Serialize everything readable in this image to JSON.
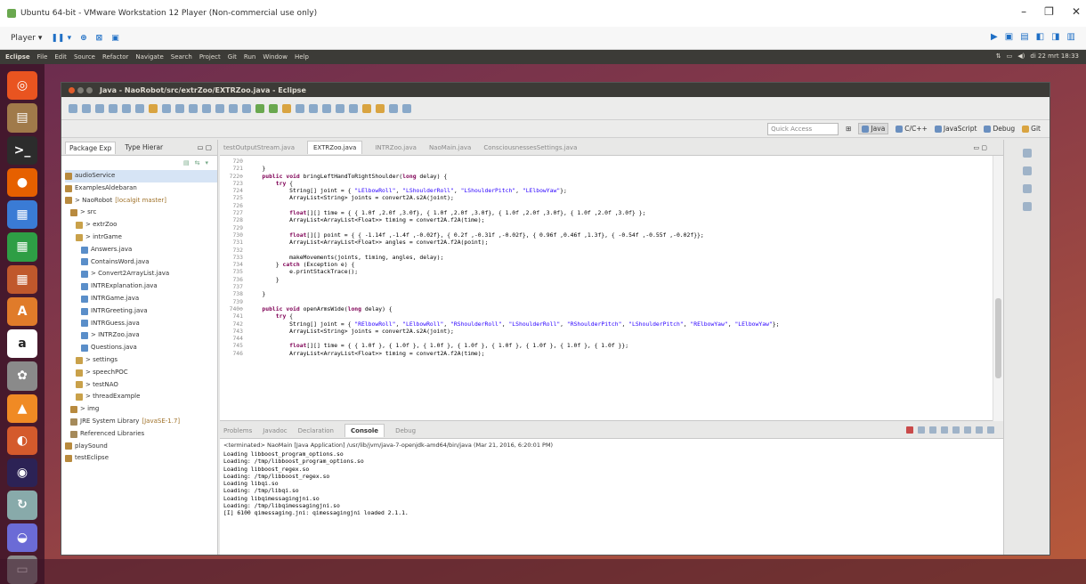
{
  "vmware": {
    "title": "Ubuntu 64-bit - VMware Workstation 12 Player (Non-commercial use only)",
    "player_menu": "Player ▾",
    "window_controls": [
      "–",
      "❐",
      "✕"
    ]
  },
  "ubuntu_panel": {
    "app_name": "Eclipse",
    "menus": [
      "File",
      "Edit",
      "Source",
      "Refactor",
      "Navigate",
      "Search",
      "Project",
      "Git",
      "Run",
      "Window",
      "Help"
    ],
    "clock": "di 22 mrt 18:33"
  },
  "eclipse": {
    "title": "Java - NaoRobot/src/extrZoo/EXTRZoo.java - Eclipse",
    "quick_access_placeholder": "Quick Access",
    "perspectives": [
      "Java",
      "C/C++",
      "JavaScript",
      "Debug",
      "Git"
    ]
  },
  "package_explorer": {
    "tabs": [
      "Package Exp",
      "Type Hierar"
    ],
    "tree": [
      {
        "label": "audioService",
        "git": "",
        "depth": 0,
        "icon": "project-icon",
        "selected": true
      },
      {
        "label": "ExamplesAldebaran",
        "git": "",
        "depth": 0,
        "icon": "project-icon",
        "selected": false
      },
      {
        "label": "> NaoRobot",
        "git": "[localgit master]",
        "depth": 0,
        "icon": "project-icon",
        "selected": false
      },
      {
        "label": "> src",
        "git": "",
        "depth": 1,
        "icon": "folder-icon",
        "selected": false
      },
      {
        "label": "> extrZoo",
        "git": "",
        "depth": 2,
        "icon": "package-icon",
        "selected": false
      },
      {
        "label": "> intrGame",
        "git": "",
        "depth": 2,
        "icon": "package-icon",
        "selected": false
      },
      {
        "label": "Answers.java",
        "git": "",
        "depth": 3,
        "icon": "java-file-icon",
        "selected": false
      },
      {
        "label": "ContainsWord.java",
        "git": "",
        "depth": 3,
        "icon": "java-file-icon",
        "selected": false
      },
      {
        "label": "> Convert2ArrayList.java",
        "git": "",
        "depth": 3,
        "icon": "java-file-icon",
        "selected": false
      },
      {
        "label": "INTRExplanation.java",
        "git": "",
        "depth": 3,
        "icon": "java-file-icon",
        "selected": false
      },
      {
        "label": "INTRGame.java",
        "git": "",
        "depth": 3,
        "icon": "java-file-icon",
        "selected": false
      },
      {
        "label": "INTRGreeting.java",
        "git": "",
        "depth": 3,
        "icon": "java-file-icon",
        "selected": false
      },
      {
        "label": "INTRGuess.java",
        "git": "",
        "depth": 3,
        "icon": "java-file-icon",
        "selected": false
      },
      {
        "label": "> INTRZoo.java",
        "git": "",
        "depth": 3,
        "icon": "java-file-icon",
        "selected": false
      },
      {
        "label": "Questions.java",
        "git": "",
        "depth": 3,
        "icon": "java-file-icon",
        "selected": false
      },
      {
        "label": "> settings",
        "git": "",
        "depth": 2,
        "icon": "package-icon",
        "selected": false
      },
      {
        "label": "> speechPOC",
        "git": "",
        "depth": 2,
        "icon": "package-icon",
        "selected": false
      },
      {
        "label": "> testNAO",
        "git": "",
        "depth": 2,
        "icon": "package-icon",
        "selected": false
      },
      {
        "label": "> threadExample",
        "git": "",
        "depth": 2,
        "icon": "package-icon",
        "selected": false
      },
      {
        "label": "> img",
        "git": "",
        "depth": 1,
        "icon": "folder-icon",
        "selected": false
      },
      {
        "label": "JRE System Library",
        "git": "[JavaSE-1.7]",
        "depth": 1,
        "icon": "library-icon",
        "selected": false
      },
      {
        "label": "Referenced Libraries",
        "git": "",
        "depth": 1,
        "icon": "library-icon",
        "selected": false
      },
      {
        "label": "playSound",
        "git": "",
        "depth": 0,
        "icon": "project-icon",
        "selected": false
      },
      {
        "label": "testEclipse",
        "git": "",
        "depth": 0,
        "icon": "project-icon",
        "selected": false
      }
    ]
  },
  "editor": {
    "tabs": [
      {
        "label": "testOutputStream.java",
        "active": false
      },
      {
        "label": "EXTRZoo.java",
        "active": true
      },
      {
        "label": "INTRZoo.java",
        "active": false
      },
      {
        "label": "NaoMain.java",
        "active": false
      },
      {
        "label": "ConsciousnessesSettings.java",
        "active": false
      }
    ],
    "lines": [
      {
        "n": "720",
        "t": ""
      },
      {
        "n": "721",
        "t": "    }"
      },
      {
        "n": "722⊖",
        "t": "    public void bringLeftHandToRightShoulder(long delay) {"
      },
      {
        "n": "723",
        "t": "        try {"
      },
      {
        "n": "724",
        "t": "            String[] joint = { \"LElbowRoll\", \"LShoulderRoll\", \"LShoulderPitch\", \"LElbowYaw\"};"
      },
      {
        "n": "725",
        "t": "            ArrayList<String> joints = convert2A.s2A(joint);"
      },
      {
        "n": "726",
        "t": ""
      },
      {
        "n": "727",
        "t": "            float[][] time = { { 1.0f ,2.0f ,3.0f}, { 1.0f ,2.0f ,3.0f}, { 1.0f ,2.0f ,3.0f}, { 1.0f ,2.0f ,3.0f} };"
      },
      {
        "n": "728",
        "t": "            ArrayList<ArrayList<Float>> timing = convert2A.f2A(time);"
      },
      {
        "n": "729",
        "t": ""
      },
      {
        "n": "730",
        "t": "            float[][] point = { { -1.14f ,-1.4f ,-0.02f}, { 0.2f ,-0.31f ,-0.02f}, { 0.96f ,0.46f ,1.3f}, { -0.54f ,-0.55f ,-0.02f}};"
      },
      {
        "n": "731",
        "t": "            ArrayList<ArrayList<Float>> angles = convert2A.f2A(point);"
      },
      {
        "n": "732",
        "t": ""
      },
      {
        "n": "733",
        "t": "            makeMovements(joints, timing, angles, delay);"
      },
      {
        "n": "734",
        "t": "        } catch (Exception e) {"
      },
      {
        "n": "735",
        "t": "            e.printStackTrace();"
      },
      {
        "n": "736",
        "t": "        }"
      },
      {
        "n": "737",
        "t": ""
      },
      {
        "n": "738",
        "t": "    }"
      },
      {
        "n": "739",
        "t": ""
      },
      {
        "n": "740⊖",
        "t": "    public void openArmsWide(long delay) {"
      },
      {
        "n": "741",
        "t": "        try {"
      },
      {
        "n": "742",
        "t": "            String[] joint = { \"RElbowRoll\", \"LElbowRoll\", \"RShoulderRoll\", \"LShoulderRoll\", \"RShoulderPitch\", \"LShoulderPitch\", \"RElbowYaw\", \"LElbowYaw\"};"
      },
      {
        "n": "743",
        "t": "            ArrayList<String> joints = convert2A.s2A(joint);"
      },
      {
        "n": "744",
        "t": ""
      },
      {
        "n": "745",
        "t": "            float[][] time = { { 1.0f }, { 1.0f }, { 1.0f }, { 1.0f }, { 1.0f }, { 1.0f }, { 1.0f }, { 1.0f }};"
      },
      {
        "n": "746",
        "t": "            ArrayList<ArrayList<Float>> timing = convert2A.f2A(time);"
      }
    ]
  },
  "console": {
    "tabs": [
      {
        "label": "Problems",
        "active": false
      },
      {
        "label": "Javadoc",
        "active": false
      },
      {
        "label": "Declaration",
        "active": false
      },
      {
        "label": "Console",
        "active": true
      },
      {
        "label": "Debug",
        "active": false
      }
    ],
    "terminated": "<terminated> NaoMain [Java Application] /usr/lib/jvm/java-7-openjdk-amd64/bin/java (Mar 21, 2016, 6:20:01 PM)",
    "lines": [
      "Loading libboost_program_options.so",
      "Loading: /tmp/libboost_program_options.so",
      "Loading libboost_regex.so",
      "Loading: /tmp/libboost_regex.so",
      "Loading libqi.so",
      "Loading: /tmp/libqi.so",
      "Loading libqimessagingjni.so",
      "Loading: /tmp/libqimessagingjni.so",
      "[I] 6100 qimessaging.jni: qimessagingjni loaded 2.1.1."
    ]
  },
  "launcher": {
    "icons": [
      {
        "name": "dash-icon",
        "glyph": "◎",
        "color": "#e95420"
      },
      {
        "name": "files-icon",
        "glyph": "▤",
        "color": "#a07a4a"
      },
      {
        "name": "terminal-icon",
        "glyph": ">_",
        "color": "#2c2c2c"
      },
      {
        "name": "firefox-icon",
        "glyph": "●",
        "color": "#e66000"
      },
      {
        "name": "writer-icon",
        "glyph": "▦",
        "color": "#3a7bd5"
      },
      {
        "name": "calc-icon",
        "glyph": "▦",
        "color": "#2e9e45"
      },
      {
        "name": "impress-icon",
        "glyph": "▦",
        "color": "#c0582c"
      },
      {
        "name": "software-center-icon",
        "glyph": "A",
        "color": "#e07b2a"
      },
      {
        "name": "amazon-icon",
        "glyph": "a",
        "color": "#ffffff"
      },
      {
        "name": "settings-icon",
        "glyph": "✿",
        "color": "#8a8a8a"
      },
      {
        "name": "vlc-icon",
        "glyph": "▲",
        "color": "#f08a24"
      },
      {
        "name": "ubuntu-one-icon",
        "glyph": "◐",
        "color": "#d45a2c"
      },
      {
        "name": "eclipse-icon",
        "glyph": "◉",
        "color": "#2c2255"
      },
      {
        "name": "update-icon",
        "glyph": "↻",
        "color": "#8aa"
      },
      {
        "name": "disk-icon",
        "glyph": "◒",
        "color": "#6b6bd6"
      },
      {
        "name": "trash-icon",
        "glyph": "▭",
        "color": "#8a8a8a"
      }
    ]
  }
}
